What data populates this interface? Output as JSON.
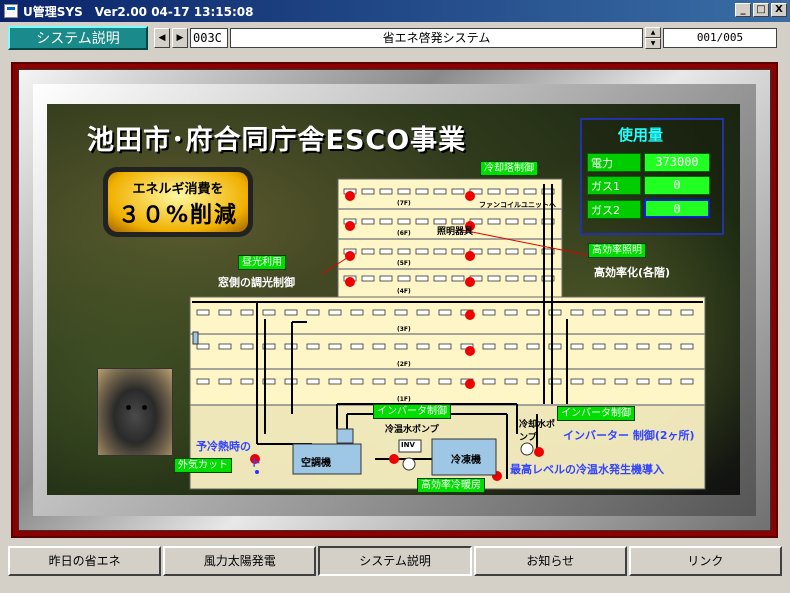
{
  "window": {
    "title": "U管理SYS　Ver2.00 04-17 13:15:08",
    "btn_min": "_",
    "btn_max": "□",
    "btn_close": "X"
  },
  "toolbar": {
    "section": "システム説明",
    "prev": "◀",
    "next": "▶",
    "code": "003C",
    "page_title": "省エネ啓発システム",
    "page": "001/005"
  },
  "slide": {
    "headline": "池田市･府合同庁舎ESCO事業",
    "energy_line1": "エネルギ消費を",
    "energy_line2": "３０%削減",
    "usage": {
      "title": "使用量",
      "rows": [
        {
          "label": "電力",
          "value": "373000"
        },
        {
          "label": "ガス1",
          "value": "0"
        },
        {
          "label": "ガス2",
          "value": "0"
        }
      ]
    },
    "tags": {
      "cooling_tower": "冷却塔制御",
      "daylight": "昼光利用",
      "high_eff_lighting": "高効率照明",
      "inverter1": "インバータ制御",
      "inverter2": "インバータ制御",
      "outside_air": "外気カット",
      "high_eff_hvac": "高効率冷暖房"
    },
    "labels": {
      "window_dimming": "窓側の調光制御",
      "high_eff_floors": "高効率化(各階)",
      "fixtures": "照明器具",
      "fancoil": "ファンコイルユニットへ",
      "chilled_pump": "冷温水ポンプ",
      "cooling_pump": "冷却水ポンプ",
      "inverter_control": "インバーター 制御(2ヶ所)",
      "precool": "予冷熱時の",
      "precool2": "ト",
      "chiller_intro": "最高レベルの冷温水発生機導入",
      "ahu": "空調機",
      "chiller": "冷凍機",
      "inv": "INV"
    },
    "floors": [
      "(7F)",
      "(6F)",
      "(5F)",
      "(4F)",
      "(3F)",
      "(2F)",
      "(1F)"
    ]
  },
  "tabs": [
    "昨日の省エネ",
    "風力太陽発電",
    "システム説明",
    "お知らせ",
    "リンク"
  ]
}
